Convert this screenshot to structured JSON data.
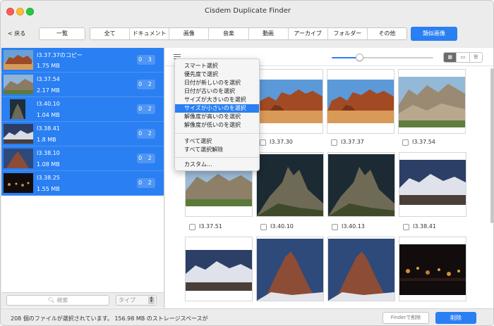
{
  "window": {
    "title": "Cisdem Duplicate Finder"
  },
  "toolbar": {
    "back_label": "< 戻る",
    "list_label": "一覧",
    "categories": [
      "全て",
      "ドキュメント",
      "画像",
      "音楽",
      "動画",
      "アーカイブ",
      "フォルダー",
      "その他"
    ],
    "similar_label": "類似画像"
  },
  "sidebar": {
    "items": [
      {
        "name": "I3.37.37のコピー",
        "size": "1.75 MB",
        "count": "0 3"
      },
      {
        "name": "I3.37.54",
        "size": "2.17 MB",
        "count": "0 2"
      },
      {
        "name": "I3.40.10",
        "size": "1.04 MB",
        "count": "0 2"
      },
      {
        "name": "I3.38.41",
        "size": "1.8 MB",
        "count": "0 2"
      },
      {
        "name": "I3.38.10",
        "size": "1.08 MB",
        "count": "0 2"
      },
      {
        "name": "I3.38.25",
        "size": "1.55 MB",
        "count": "0 2"
      }
    ],
    "search_placeholder": "検索",
    "type_label": "タイプ"
  },
  "menu": {
    "items": [
      "スマート選択",
      "優先度で選択",
      "日付が新しいのを選択",
      "日付が古いのを選択",
      "サイズが大きいのを選択",
      "サイズが小さいのを選択",
      "解像度が高いのを選択",
      "解像度が低いのを選択"
    ],
    "items2": [
      "すべて選択",
      "すべて選択解除"
    ],
    "items3": [
      "カスタム..."
    ],
    "selected": "サイズが小さいのを選択"
  },
  "grid": {
    "captions": [
      "I3.37.30",
      "I3.37.37",
      "I3.37.54",
      "I3.37.51",
      "I3.40.10",
      "I3.40.13",
      "I3.38.41"
    ]
  },
  "slider": {
    "value": 0.27
  },
  "status": {
    "text": "208 個のファイルが選択されています。 156.98 MB のストレージスペースが",
    "finder_label": "Finderで削除",
    "delete_label": "削除"
  },
  "colors": {
    "accent": "#2a7ff2"
  }
}
